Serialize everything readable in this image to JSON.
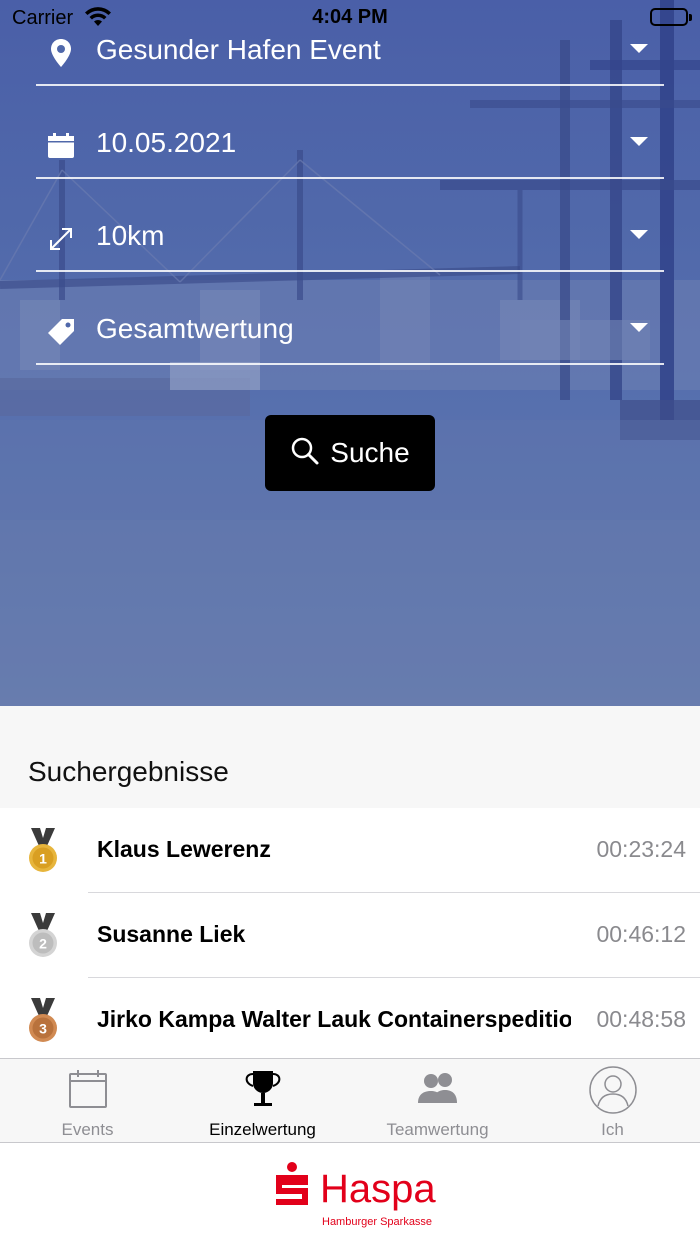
{
  "status_bar": {
    "carrier": "Carrier",
    "time": "4:04 PM"
  },
  "filters": {
    "event": {
      "value": "Gesunder Hafen Event",
      "icon": "location-pin-icon"
    },
    "date": {
      "value": "10.05.2021",
      "icon": "calendar-icon"
    },
    "distance": {
      "value": "10km",
      "icon": "resize-arrows-icon"
    },
    "category": {
      "value": "Gesamtwertung",
      "icon": "tag-icon"
    }
  },
  "search_button": {
    "label": "Suche",
    "icon": "search-icon"
  },
  "results": {
    "title": "Suchergebnisse",
    "rows": [
      {
        "rank": "1",
        "medal": "gold",
        "name": "Klaus Lewerenz",
        "time": "00:23:24"
      },
      {
        "rank": "2",
        "medal": "silver",
        "name": "Susanne Liek",
        "time": "00:46:12"
      },
      {
        "rank": "3",
        "medal": "bronze",
        "name": "Jirko Kampa Walter Lauk Containerspedition",
        "time": "00:48:58"
      }
    ]
  },
  "tabs": [
    {
      "label": "Events",
      "icon": "calendar-icon",
      "active": false
    },
    {
      "label": "Einzelwertung",
      "icon": "trophy-icon",
      "active": true
    },
    {
      "label": "Teamwertung",
      "icon": "team-icon",
      "active": false
    },
    {
      "label": "Ich",
      "icon": "profile-icon",
      "active": false
    }
  ],
  "brand": {
    "name": "Haspa",
    "subtitle": "Hamburger Sparkasse"
  },
  "colors": {
    "brand_red": "#e2001a",
    "hero_blue": "#5068aa",
    "accent_black": "#000000",
    "muted_text": "#8a8a8e"
  }
}
